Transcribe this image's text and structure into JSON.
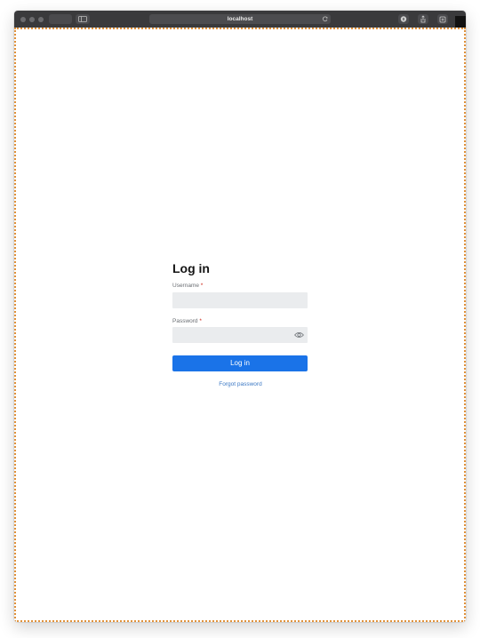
{
  "browser": {
    "address": "localhost"
  },
  "login": {
    "title": "Log in",
    "username_label": "Username",
    "password_label": "Password",
    "required_marker": "*",
    "username_value": "",
    "password_value": "",
    "submit_label": "Log in",
    "forgot_label": "Forgot password"
  },
  "colors": {
    "accent": "#1a73e8",
    "link": "#3b78c4",
    "field_bg": "#eaecee",
    "viewport_border": "#e0913a"
  },
  "icons": [
    "sidebar-icon",
    "reload-icon",
    "privacy-icon",
    "share-icon",
    "new-tab-icon",
    "eye-icon"
  ]
}
